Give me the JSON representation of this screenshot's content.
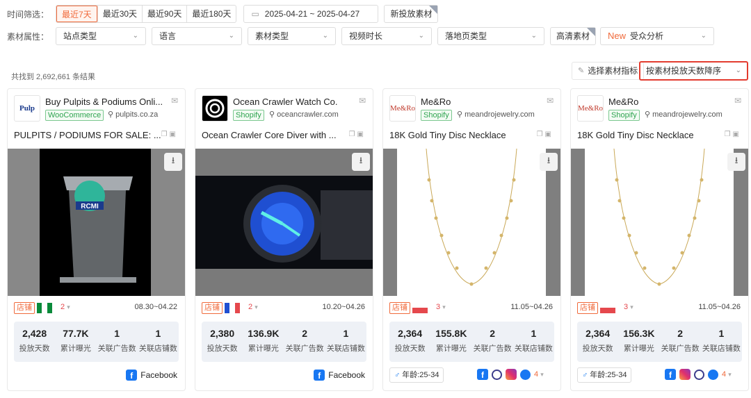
{
  "filters": {
    "time_label": "时间筛选：",
    "time_tabs": [
      "最近7天",
      "最近30天",
      "最近90天",
      "最近180天"
    ],
    "date_range": "2025-04-21 ~ 2025-04-27",
    "new_material": "新投放素材",
    "attr_label": "素材属性：",
    "site_type": "站点类型",
    "language": "语言",
    "material_type": "素材类型",
    "video_duration": "视频时长",
    "landing_type": "落地页类型",
    "hd": "高清素材",
    "new_badge": "New",
    "audience": "受众分析"
  },
  "results": {
    "count": "共找到 2,692,661 条结果",
    "pick_metrics": "选择素材指标",
    "sort": "按素材投放天数降序"
  },
  "cards": [
    {
      "shop": "Buy Pulpits & Podiums Onli...",
      "platform": "WooCommerce",
      "domain": "pulpits.co.za",
      "title": "PULPITS / PODIUMS FOR SALE: ...",
      "store_tag": "店铺",
      "region_count": "2",
      "dates": "08.30~04.22",
      "days": "2,428",
      "exposure": "77.7K",
      "ads": "1",
      "stores": "1",
      "k_days": "投放天数",
      "k_exp": "累计曝光",
      "k_ads": "关联广告数",
      "k_stores": "关联店铺数",
      "fb": "Facebook",
      "logo_text": "Pulp",
      "media_text": "RCMI"
    },
    {
      "shop": "Ocean Crawler Watch Co.",
      "platform": "Shopify",
      "domain": "oceancrawler.com",
      "title": "Ocean Crawler Core Diver with ...",
      "store_tag": "店铺",
      "region_count": "2",
      "dates": "10.20~04.26",
      "days": "2,380",
      "exposure": "136.9K",
      "ads": "2",
      "stores": "1",
      "k_days": "投放天数",
      "k_exp": "累计曝光",
      "k_ads": "关联广告数",
      "k_stores": "关联店铺数",
      "fb": "Facebook"
    },
    {
      "shop": "Me&Ro",
      "platform": "Shopify",
      "domain": "meandrojewelry.com",
      "title": "18K Gold Tiny Disc Necklace",
      "store_tag": "店铺",
      "region_count": "3",
      "dates": "11.05~04.26",
      "days": "2,364",
      "exposure": "155.8K",
      "ads": "2",
      "stores": "1",
      "k_days": "投放天数",
      "k_exp": "累计曝光",
      "k_ads": "关联广告数",
      "k_stores": "关联店铺数",
      "age": "年龄:25-34",
      "platform_count": "4",
      "logo_text": "Me&Ro"
    },
    {
      "shop": "Me&Ro",
      "platform": "Shopify",
      "domain": "meandrojewelry.com",
      "title": "18K Gold Tiny Disc Necklace",
      "store_tag": "店铺",
      "region_count": "3",
      "dates": "11.05~04.26",
      "days": "2,364",
      "exposure": "156.3K",
      "ads": "2",
      "stores": "1",
      "k_days": "投放天数",
      "k_exp": "累计曝光",
      "k_ads": "关联广告数",
      "k_stores": "关联店铺数",
      "age": "年龄:25-34",
      "platform_count": "4",
      "logo_text": "Me&Ro"
    }
  ],
  "colors": {
    "accent": "#f06a3b",
    "sort_border": "#e33b2e",
    "facebook": "#1877f2",
    "shopify": "#2ea44f"
  }
}
